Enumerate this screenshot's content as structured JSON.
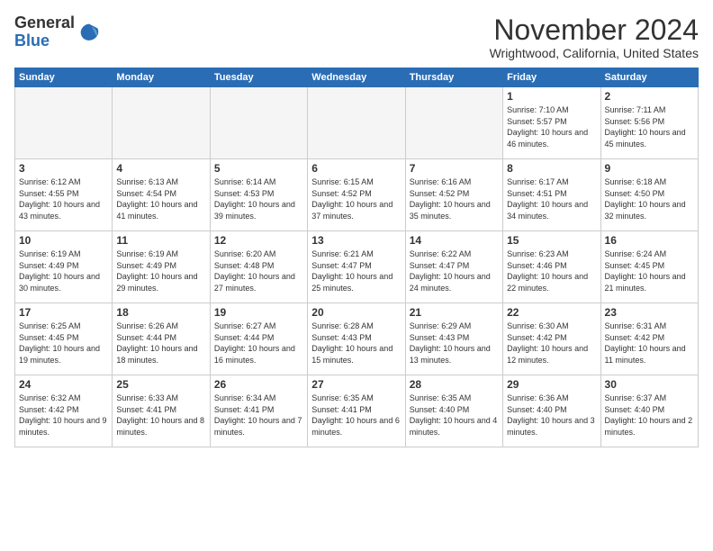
{
  "logo": {
    "general": "General",
    "blue": "Blue"
  },
  "header": {
    "month": "November 2024",
    "location": "Wrightwood, California, United States"
  },
  "weekdays": [
    "Sunday",
    "Monday",
    "Tuesday",
    "Wednesday",
    "Thursday",
    "Friday",
    "Saturday"
  ],
  "weeks": [
    [
      {
        "day": "",
        "info": ""
      },
      {
        "day": "",
        "info": ""
      },
      {
        "day": "",
        "info": ""
      },
      {
        "day": "",
        "info": ""
      },
      {
        "day": "",
        "info": ""
      },
      {
        "day": "1",
        "info": "Sunrise: 7:10 AM\nSunset: 5:57 PM\nDaylight: 10 hours and 46 minutes."
      },
      {
        "day": "2",
        "info": "Sunrise: 7:11 AM\nSunset: 5:56 PM\nDaylight: 10 hours and 45 minutes."
      }
    ],
    [
      {
        "day": "3",
        "info": "Sunrise: 6:12 AM\nSunset: 4:55 PM\nDaylight: 10 hours and 43 minutes."
      },
      {
        "day": "4",
        "info": "Sunrise: 6:13 AM\nSunset: 4:54 PM\nDaylight: 10 hours and 41 minutes."
      },
      {
        "day": "5",
        "info": "Sunrise: 6:14 AM\nSunset: 4:53 PM\nDaylight: 10 hours and 39 minutes."
      },
      {
        "day": "6",
        "info": "Sunrise: 6:15 AM\nSunset: 4:52 PM\nDaylight: 10 hours and 37 minutes."
      },
      {
        "day": "7",
        "info": "Sunrise: 6:16 AM\nSunset: 4:52 PM\nDaylight: 10 hours and 35 minutes."
      },
      {
        "day": "8",
        "info": "Sunrise: 6:17 AM\nSunset: 4:51 PM\nDaylight: 10 hours and 34 minutes."
      },
      {
        "day": "9",
        "info": "Sunrise: 6:18 AM\nSunset: 4:50 PM\nDaylight: 10 hours and 32 minutes."
      }
    ],
    [
      {
        "day": "10",
        "info": "Sunrise: 6:19 AM\nSunset: 4:49 PM\nDaylight: 10 hours and 30 minutes."
      },
      {
        "day": "11",
        "info": "Sunrise: 6:19 AM\nSunset: 4:49 PM\nDaylight: 10 hours and 29 minutes."
      },
      {
        "day": "12",
        "info": "Sunrise: 6:20 AM\nSunset: 4:48 PM\nDaylight: 10 hours and 27 minutes."
      },
      {
        "day": "13",
        "info": "Sunrise: 6:21 AM\nSunset: 4:47 PM\nDaylight: 10 hours and 25 minutes."
      },
      {
        "day": "14",
        "info": "Sunrise: 6:22 AM\nSunset: 4:47 PM\nDaylight: 10 hours and 24 minutes."
      },
      {
        "day": "15",
        "info": "Sunrise: 6:23 AM\nSunset: 4:46 PM\nDaylight: 10 hours and 22 minutes."
      },
      {
        "day": "16",
        "info": "Sunrise: 6:24 AM\nSunset: 4:45 PM\nDaylight: 10 hours and 21 minutes."
      }
    ],
    [
      {
        "day": "17",
        "info": "Sunrise: 6:25 AM\nSunset: 4:45 PM\nDaylight: 10 hours and 19 minutes."
      },
      {
        "day": "18",
        "info": "Sunrise: 6:26 AM\nSunset: 4:44 PM\nDaylight: 10 hours and 18 minutes."
      },
      {
        "day": "19",
        "info": "Sunrise: 6:27 AM\nSunset: 4:44 PM\nDaylight: 10 hours and 16 minutes."
      },
      {
        "day": "20",
        "info": "Sunrise: 6:28 AM\nSunset: 4:43 PM\nDaylight: 10 hours and 15 minutes."
      },
      {
        "day": "21",
        "info": "Sunrise: 6:29 AM\nSunset: 4:43 PM\nDaylight: 10 hours and 13 minutes."
      },
      {
        "day": "22",
        "info": "Sunrise: 6:30 AM\nSunset: 4:42 PM\nDaylight: 10 hours and 12 minutes."
      },
      {
        "day": "23",
        "info": "Sunrise: 6:31 AM\nSunset: 4:42 PM\nDaylight: 10 hours and 11 minutes."
      }
    ],
    [
      {
        "day": "24",
        "info": "Sunrise: 6:32 AM\nSunset: 4:42 PM\nDaylight: 10 hours and 9 minutes."
      },
      {
        "day": "25",
        "info": "Sunrise: 6:33 AM\nSunset: 4:41 PM\nDaylight: 10 hours and 8 minutes."
      },
      {
        "day": "26",
        "info": "Sunrise: 6:34 AM\nSunset: 4:41 PM\nDaylight: 10 hours and 7 minutes."
      },
      {
        "day": "27",
        "info": "Sunrise: 6:35 AM\nSunset: 4:41 PM\nDaylight: 10 hours and 6 minutes."
      },
      {
        "day": "28",
        "info": "Sunrise: 6:35 AM\nSunset: 4:40 PM\nDaylight: 10 hours and 4 minutes."
      },
      {
        "day": "29",
        "info": "Sunrise: 6:36 AM\nSunset: 4:40 PM\nDaylight: 10 hours and 3 minutes."
      },
      {
        "day": "30",
        "info": "Sunrise: 6:37 AM\nSunset: 4:40 PM\nDaylight: 10 hours and 2 minutes."
      }
    ]
  ]
}
